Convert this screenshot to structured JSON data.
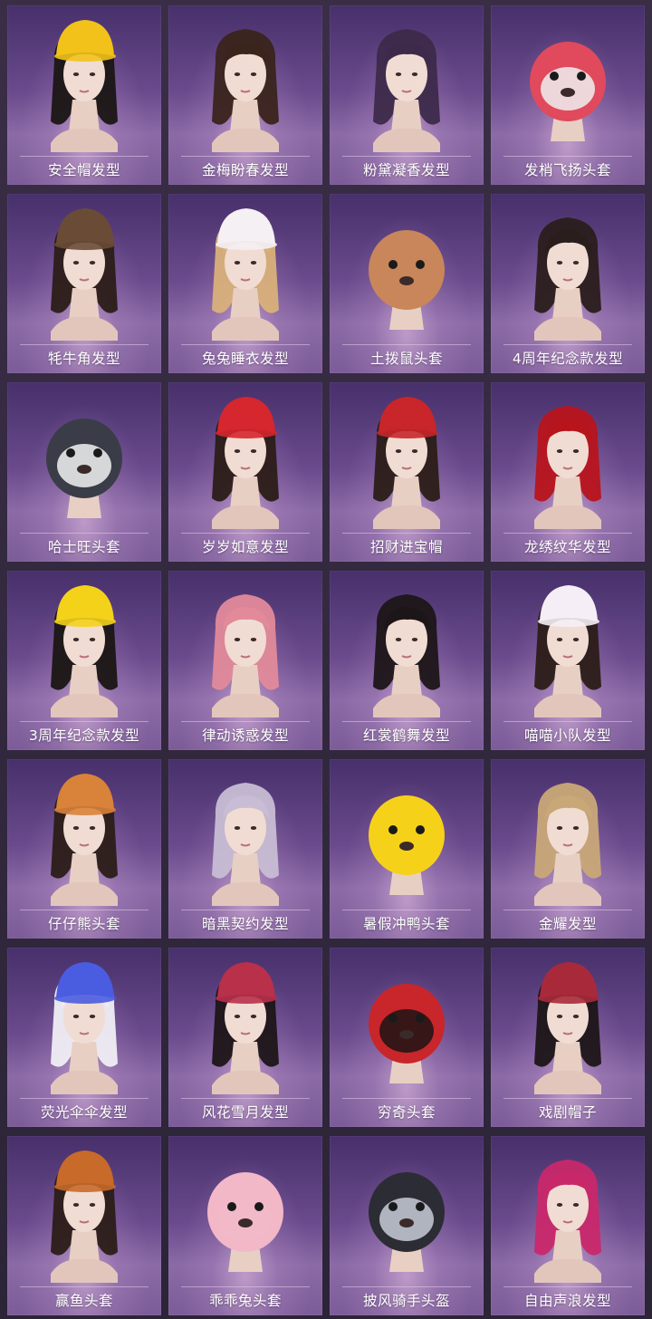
{
  "items": [
    {
      "name": "安全帽发型",
      "icon": "hardhat-hairstyle-icon",
      "hat": "#f2c21a",
      "hair": "#1a1614",
      "kind": "human"
    },
    {
      "name": "金梅盼春发型",
      "icon": "bun-hairstyle-icon",
      "hat": "",
      "hair": "#3a241c",
      "kind": "human"
    },
    {
      "name": "粉黛凝香发型",
      "icon": "purple-bob-hairstyle-icon",
      "hat": "",
      "hair": "#3d2a4a",
      "kind": "human"
    },
    {
      "name": "发梢飞扬头套",
      "icon": "unicorn-mask-icon",
      "hat": "#e04a5c",
      "hair": "#f0f0f0",
      "kind": "mask"
    },
    {
      "name": "牦牛角发型",
      "icon": "yak-horn-hairstyle-icon",
      "hat": "#6a4c36",
      "hair": "#2b1d18",
      "kind": "human"
    },
    {
      "name": "兔兔睡衣发型",
      "icon": "bunny-nightcap-hairstyle-icon",
      "hat": "#f4f0f4",
      "hair": "#d9b07a",
      "kind": "human"
    },
    {
      "name": "土拨鼠头套",
      "icon": "groundhog-mask-icon",
      "hat": "#c8865a",
      "hair": "#c8865a",
      "kind": "mask"
    },
    {
      "name": "4周年纪念款发型",
      "icon": "anniversary-hairstyle-icon",
      "hat": "",
      "hair": "#2a1e1c",
      "kind": "human"
    },
    {
      "name": "哈士旺头套",
      "icon": "husky-mask-icon",
      "hat": "#3a3d48",
      "hair": "#f2f2f2",
      "kind": "mask"
    },
    {
      "name": "岁岁如意发型",
      "icon": "twin-tail-hairstyle-icon",
      "hat": "#d6262e",
      "hair": "#2b1d18",
      "kind": "human"
    },
    {
      "name": "招财进宝帽",
      "icon": "lucky-knit-hat-icon",
      "hat": "#c8262a",
      "hair": "#2b1d18",
      "kind": "human"
    },
    {
      "name": "龙绣纹华发型",
      "icon": "red-bob-hairstyle-icon",
      "hat": "",
      "hair": "#b8141c",
      "kind": "human"
    },
    {
      "name": "3周年纪念款发型",
      "icon": "cap-hairstyle-icon",
      "hat": "#f4d21a",
      "hair": "#1a1614",
      "kind": "human"
    },
    {
      "name": "律动诱惑发型",
      "icon": "pink-hairstyle-icon",
      "hat": "",
      "hair": "#e28a9a",
      "kind": "human"
    },
    {
      "name": "红裳鹤舞发型",
      "icon": "double-bun-hairstyle-icon",
      "hat": "",
      "hair": "#1c1618",
      "kind": "human"
    },
    {
      "name": "喵喵小队发型",
      "icon": "cat-cap-hairstyle-icon",
      "hat": "#f6eef6",
      "hair": "#2b1d18",
      "kind": "human"
    },
    {
      "name": "仔仔熊头套",
      "icon": "bear-hood-icon",
      "hat": "#d9823a",
      "hair": "#2b1d18",
      "kind": "human"
    },
    {
      "name": "暗黑契约发型",
      "icon": "silver-hairstyle-icon",
      "hat": "",
      "hair": "#c8bdd4",
      "kind": "human"
    },
    {
      "name": "暑假冲鸭头套",
      "icon": "duck-mask-icon",
      "hat": "#f6d11a",
      "hair": "#f6d11a",
      "kind": "mask"
    },
    {
      "name": "金耀发型",
      "icon": "blonde-hairstyle-icon",
      "hat": "",
      "hair": "#c9a878",
      "kind": "human"
    },
    {
      "name": "荧光伞伞发型",
      "icon": "mushroom-hat-icon",
      "hat": "#4a5ce0",
      "hair": "#f0eef4",
      "kind": "human"
    },
    {
      "name": "风花雪月发型",
      "icon": "embroidered-hat-icon",
      "hat": "#b8304a",
      "hair": "#1c1618",
      "kind": "human"
    },
    {
      "name": "穷奇头套",
      "icon": "dragon-mask-icon",
      "hat": "#c8262a",
      "hair": "#1c1414",
      "kind": "mask"
    },
    {
      "name": "戏剧帽子",
      "icon": "jester-hat-icon",
      "hat": "#a82a3a",
      "hair": "#1c1618",
      "kind": "human"
    },
    {
      "name": "赢鱼头套",
      "icon": "fish-mask-icon",
      "hat": "#c86a2a",
      "hair": "#2b1d18",
      "kind": "human"
    },
    {
      "name": "乖乖兔头套",
      "icon": "pink-bunny-mask-icon",
      "hat": "#f2b8c8",
      "hair": "#f2b8c8",
      "kind": "mask"
    },
    {
      "name": "披风骑手头盔",
      "icon": "rider-helmet-icon",
      "hat": "#2c2c34",
      "hair": "#c8ccd8",
      "kind": "mask"
    },
    {
      "name": "自由声浪发型",
      "icon": "magenta-hairstyle-icon",
      "hat": "",
      "hair": "#c8286a",
      "kind": "human"
    }
  ]
}
